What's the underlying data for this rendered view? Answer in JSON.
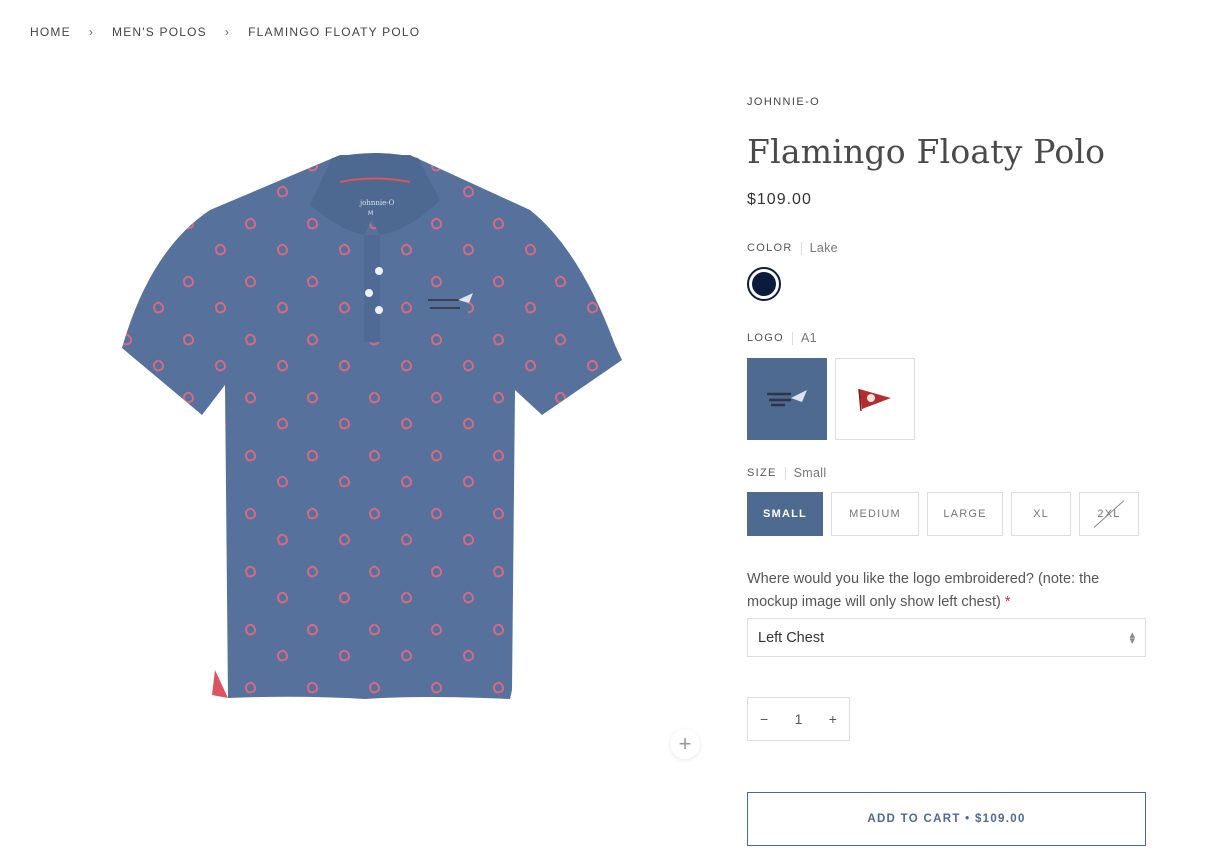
{
  "breadcrumb": {
    "home": "HOME",
    "category": "MEN'S POLOS",
    "current": "FLAMINGO FLOATY POLO",
    "separator": "›"
  },
  "product": {
    "vendor": "JOHNNIE-O",
    "title": "Flamingo Floaty Polo",
    "price": "$109.00",
    "shirt_color": "#56719b",
    "pattern_color": "#d46b82",
    "collar_tag_text": "johnnie-O",
    "collar_size_text": "M"
  },
  "options": {
    "color": {
      "label": "COLOR",
      "value": "Lake",
      "swatch_hex": "#0c1a3d"
    },
    "logo": {
      "label": "LOGO",
      "value": "A1",
      "tiles": [
        "Indian Creek logo",
        "Red pennant logo"
      ]
    },
    "size": {
      "label": "SIZE",
      "value": "Small",
      "choices": [
        {
          "label": "SMALL",
          "state": "selected"
        },
        {
          "label": "MEDIUM",
          "state": "available"
        },
        {
          "label": "LARGE",
          "state": "available"
        },
        {
          "label": "XL",
          "state": "available"
        },
        {
          "label": "2XL",
          "state": "unavailable"
        }
      ]
    }
  },
  "embroidery": {
    "question": "Where would you like the logo embroidered? (note: the mockup image will only show left chest)",
    "required_mark": "*",
    "selected": "Left Chest"
  },
  "quantity": {
    "minus": "−",
    "value": "1",
    "plus": "+"
  },
  "cart": {
    "button": "ADD TO CART • $109.00"
  },
  "gallery": {
    "zoom_symbol": "+"
  },
  "colors": {
    "accent": "#4f6a90"
  }
}
